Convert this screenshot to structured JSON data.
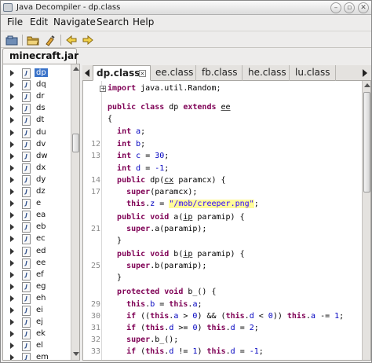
{
  "window": {
    "title": "Java Decompiler - dp.class"
  },
  "menu": [
    "File",
    "Edit",
    "Navigate",
    "Search",
    "Help"
  ],
  "toolbar": {
    "icons": [
      "open-file-icon",
      "open-folder-icon",
      "search-icon",
      "back-icon",
      "forward-icon"
    ]
  },
  "jar_tab": {
    "label": "minecraft.jar"
  },
  "tree": {
    "items": [
      "dp",
      "dq",
      "dr",
      "ds",
      "dt",
      "du",
      "dv",
      "dw",
      "dx",
      "dy",
      "dz",
      "e",
      "ea",
      "eb",
      "ec",
      "ed",
      "ee",
      "ef",
      "eg",
      "eh",
      "ei",
      "ej",
      "ek",
      "el",
      "em"
    ],
    "selected": "dp"
  },
  "file_tabs": [
    "dp.class",
    "ee.class",
    "fb.class",
    "he.class",
    "lu.class"
  ],
  "active_tab": "dp.class",
  "code": {
    "line_numbers": [
      "12",
      "13",
      "14",
      "17",
      "21",
      "25",
      "29",
      "30",
      "31",
      "32",
      "33"
    ],
    "string_literal": "\"/mob/creeper.png\""
  },
  "colors": {
    "keyword": "#7f0055",
    "field": "#0000c0",
    "string": "#2a00ff",
    "highlight": "#fffb9a",
    "selection": "#3a73c9"
  }
}
